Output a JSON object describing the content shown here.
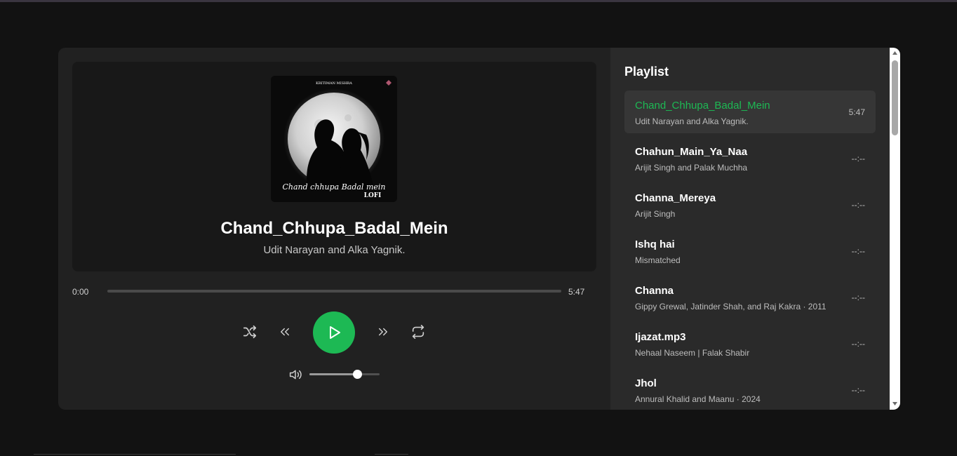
{
  "player": {
    "now_playing": {
      "title": "Chand_Chhupa_Badal_Mein",
      "artist": "Udit Narayan and Alka Yagnik.",
      "cover": {
        "top_text": "KRITIMAN MISHRA",
        "script_text": "Chand chhupa Badal mein",
        "badge_text": "LOFI"
      }
    },
    "current_time": "0:00",
    "duration": "5:47",
    "progress": 0,
    "volume": 0.68,
    "controls": {
      "shuffle": "shuffle-icon",
      "previous": "previous-icon",
      "play": "play-icon",
      "next": "next-icon",
      "repeat": "repeat-icon",
      "volume": "volume-icon"
    }
  },
  "playlist": {
    "title": "Playlist",
    "items": [
      {
        "name": "Chand_Chhupa_Badal_Mein",
        "artist": "Udit Narayan and Alka Yagnik.",
        "duration": "5:47",
        "active": true
      },
      {
        "name": "Chahun_Main_Ya_Naa",
        "artist": "Arijit Singh and Palak Muchha",
        "duration": "--:--",
        "active": false
      },
      {
        "name": "Channa_Mereya",
        "artist": "Arijit Singh",
        "duration": "--:--",
        "active": false
      },
      {
        "name": "Ishq hai",
        "artist": "Mismatched",
        "duration": "--:--",
        "active": false
      },
      {
        "name": "Channa",
        "artist": "Gippy Grewal, Jatinder Shah, and Raj Kakra · 2011",
        "duration": "--:--",
        "active": false
      },
      {
        "name": "Ijazat.mp3",
        "artist": "Nehaal Naseem | Falak Shabir",
        "duration": "--:--",
        "active": false
      },
      {
        "name": "Jhol",
        "artist": "Annural Khalid and Maanu · 2024",
        "duration": "--:--",
        "active": false
      }
    ]
  },
  "colors": {
    "accent": "#1db954",
    "background": "#121212",
    "card": "#212121",
    "playlist_bg": "#2a2a2a"
  }
}
